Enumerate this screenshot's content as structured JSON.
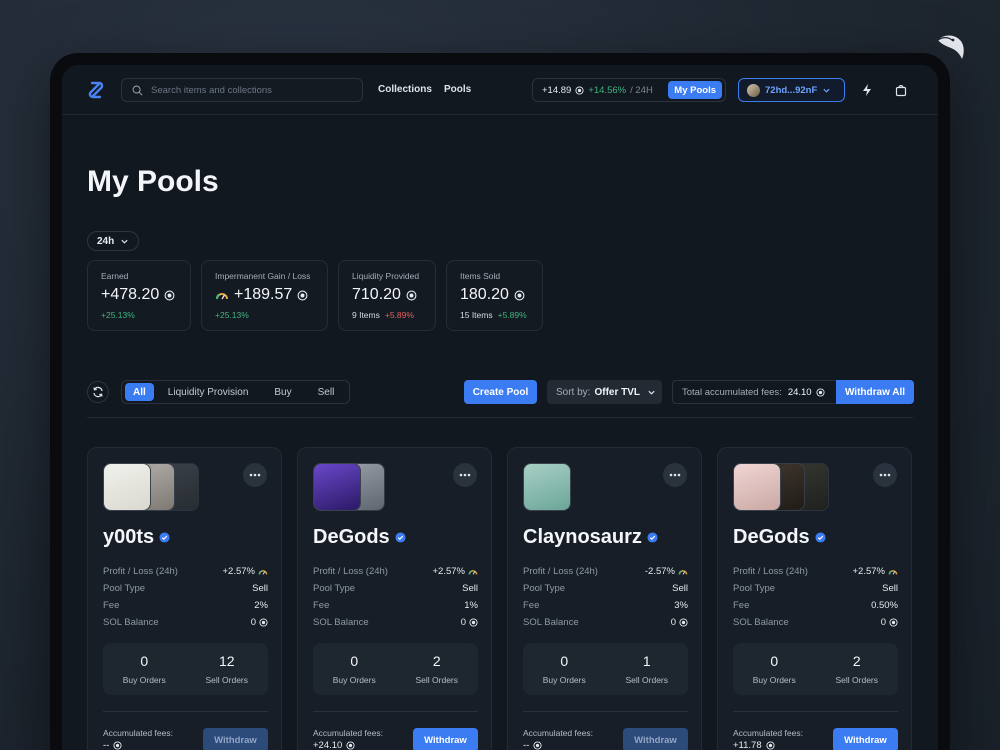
{
  "nav": {
    "search_placeholder": "Search items and collections",
    "links": [
      "Collections",
      "Pools"
    ],
    "ticker_value": "+14.89",
    "ticker_change": "+14.56%",
    "ticker_period": "/ 24H",
    "my_pools_label": "My Pools",
    "wallet_label": "72hd...92nF"
  },
  "page": {
    "title": "My Pools",
    "period": "24h"
  },
  "stats": [
    {
      "label": "Earned",
      "value": "+478.20",
      "sub_prefix": "",
      "sub": "+25.13%",
      "sub_color": "green"
    },
    {
      "label": "Impermanent Gain / Loss",
      "value": "+189.57",
      "sub_prefix": "",
      "sub": "+25.13%",
      "sub_color": "green"
    },
    {
      "label": "Liquidity Provided",
      "value": "710.20",
      "sub_prefix": "9 Items",
      "sub": "+5.89%",
      "sub_color": "red"
    },
    {
      "label": "Items Sold",
      "value": "180.20",
      "sub_prefix": "15 Items",
      "sub": "+5.89%",
      "sub_color": "green"
    }
  ],
  "toolbar": {
    "filters": [
      "All",
      "Liquidity Provision",
      "Buy",
      "Sell"
    ],
    "active_filter": "All",
    "create_pool": "Create Pool",
    "sort_label": "Sort by:",
    "sort_value": "Offer TVL",
    "fees_label": "Total accumulated fees:",
    "fees_value": "24.10",
    "withdraw_all": "Withdraw All"
  },
  "labels": {
    "profit_loss": "Profit / Loss (24h)",
    "pool_type": "Pool Type",
    "fee": "Fee",
    "sol_balance": "SOL Balance",
    "buy_orders": "Buy Orders",
    "sell_orders": "Sell Orders",
    "accumulated": "Accumulated fees:",
    "withdraw": "Withdraw"
  },
  "pools": [
    {
      "name": "y00ts",
      "pl": "+2.57%",
      "pl_color": "green",
      "type": "Sell",
      "fee": "2%",
      "sol": "0",
      "buy": "0",
      "sell": "12",
      "acc": "--",
      "withdraw_enabled": false,
      "thumbs": 3
    },
    {
      "name": "DeGods",
      "pl": "+2.57%",
      "pl_color": "green",
      "type": "Sell",
      "fee": "1%",
      "sol": "0",
      "buy": "0",
      "sell": "2",
      "acc": "+24.10",
      "withdraw_enabled": true,
      "thumbs": 2
    },
    {
      "name": "Claynosaurz",
      "pl": "-2.57%",
      "pl_color": "red",
      "type": "Sell",
      "fee": "3%",
      "sol": "0",
      "buy": "0",
      "sell": "1",
      "acc": "--",
      "withdraw_enabled": false,
      "thumbs": 1
    },
    {
      "name": "DeGods",
      "pl": "+2.57%",
      "pl_color": "green",
      "type": "Sell",
      "fee": "0.50%",
      "sol": "0",
      "buy": "0",
      "sell": "2",
      "acc": "+11.78",
      "withdraw_enabled": true,
      "thumbs": 3
    }
  ]
}
